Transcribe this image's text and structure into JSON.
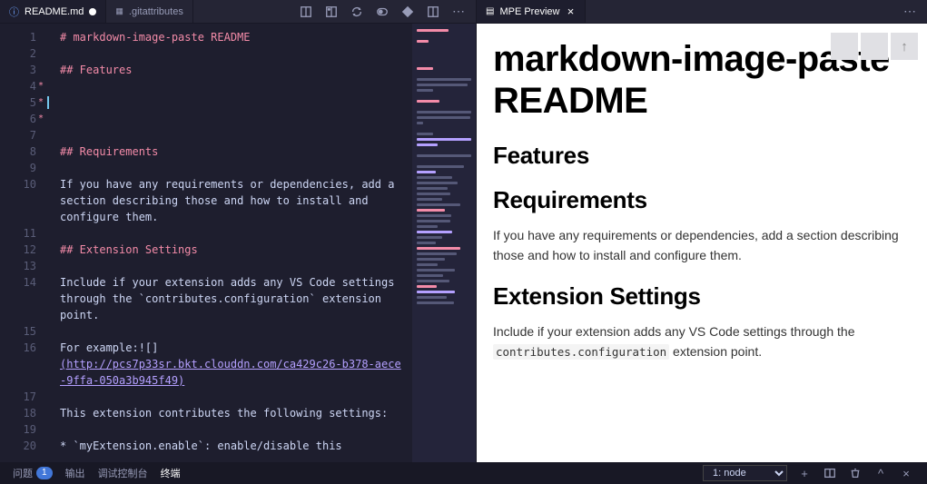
{
  "tabs": {
    "readme": {
      "label": "README.md"
    },
    "gitattr": {
      "label": ".gitattributes"
    }
  },
  "rightTab": {
    "label": "MPE Preview"
  },
  "editor": {
    "lines": [
      {
        "n": 1,
        "h": true,
        "text": "# markdown-image-paste README"
      },
      {
        "n": 2,
        "text": ""
      },
      {
        "n": 3,
        "h": true,
        "text": "## Features"
      },
      {
        "n": 4,
        "star": true,
        "text": ""
      },
      {
        "n": 5,
        "star": true,
        "cursor": true,
        "text": ""
      },
      {
        "n": 6,
        "star": true,
        "text": ""
      },
      {
        "n": 7,
        "text": ""
      },
      {
        "n": 8,
        "h": true,
        "text": "## Requirements"
      },
      {
        "n": 9,
        "text": ""
      },
      {
        "n": 10,
        "text": "If you have any requirements or dependencies, add a"
      },
      {
        "n": "",
        "text": "section describing those and how to install and"
      },
      {
        "n": "",
        "text": "configure them."
      },
      {
        "n": 11,
        "text": ""
      },
      {
        "n": 12,
        "h": true,
        "text": "## Extension Settings"
      },
      {
        "n": 13,
        "text": ""
      },
      {
        "n": 14,
        "text": "Include if your extension adds any VS Code settings"
      },
      {
        "n": "",
        "text": "through the `contributes.configuration` extension"
      },
      {
        "n": "",
        "text": "point."
      },
      {
        "n": 15,
        "text": ""
      },
      {
        "n": 16,
        "text": "For example:![]"
      },
      {
        "n": "",
        "link": true,
        "text": "(http://pcs7p33sr.bkt.clouddn.com/ca429c26-b378-aece"
      },
      {
        "n": "",
        "link": true,
        "text": "-9ffa-050a3b945f49)"
      },
      {
        "n": 17,
        "text": ""
      },
      {
        "n": 18,
        "text": "This extension contributes the following settings:"
      },
      {
        "n": 19,
        "text": ""
      },
      {
        "n": 20,
        "text": "* `myExtension.enable`: enable/disable this"
      }
    ]
  },
  "preview": {
    "h1": "markdown-image-paste README",
    "h2a": "Features",
    "h2b": "Requirements",
    "p1": "If you have any requirements or dependencies, add a section describing those and how to install and configure them.",
    "h2c": "Extension Settings",
    "p2a": "Include if your extension adds any VS Code settings through the ",
    "p2code": "contributes.configuration",
    "p2b": " extension point."
  },
  "status": {
    "problems": "问题",
    "problemsCount": "1",
    "output": "输出",
    "debugConsole": "调试控制台",
    "terminal": "终端",
    "terminalSelect": "1: node"
  }
}
